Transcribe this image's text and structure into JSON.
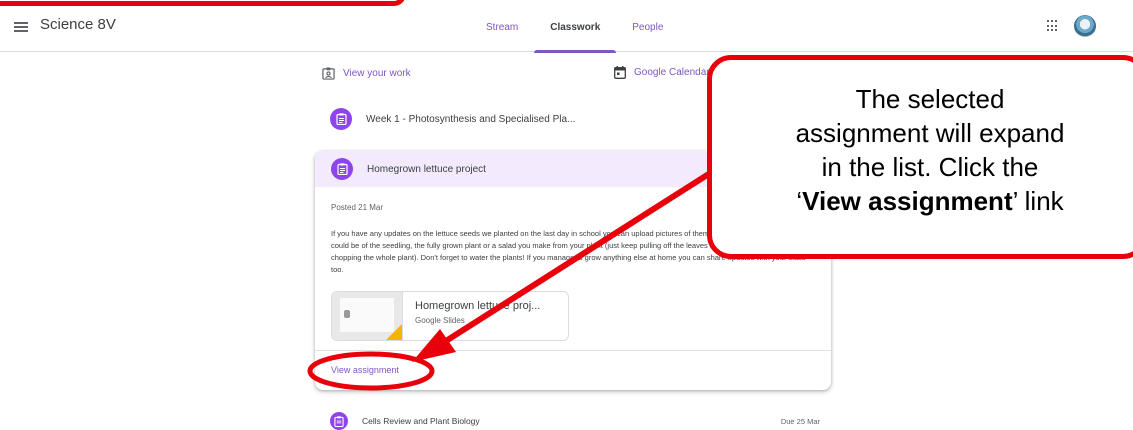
{
  "app": {
    "class_title": "Science 8V"
  },
  "tabs": [
    {
      "label": "Stream",
      "active": false
    },
    {
      "label": "Classwork",
      "active": true
    },
    {
      "label": "People",
      "active": false
    }
  ],
  "toolbar": {
    "view_your_work": "View your work",
    "google_calendar": "Google Calendar"
  },
  "topics": {
    "week1": "Week 1 - Photosynthesis and Specialised Pla..."
  },
  "assignment": {
    "title": "Homegrown lettuce project",
    "posted": "Posted 21 Mar",
    "description": "If you have any updates on the lettuce seeds we planted on the last day in school you can upload pictures of them to the Google slides. Pictures could be of the seedling, the fully grown plant or a salad you make from your plant (just keep pulling off the leaves as you need them rather than chopping the whole plant). Don't forget to water the plants! If you manage to grow anything else at home you can share updates with your class too.",
    "attachment_title": "Homegrown lettuce proj...",
    "attachment_type": "Google Slides",
    "view_assignment": "View assignment"
  },
  "next_item": {
    "title": "Cells Review and Plant Biology",
    "due": "Due 25 Mar"
  },
  "callout": {
    "line1": "The selected",
    "line2": "assignment will expand",
    "line3": "in the list. Click the",
    "quote_open": "‘",
    "bold": "View assignment",
    "quote_close": "’ link"
  },
  "colors": {
    "accent": "#7e57c2",
    "assignment_icon": "#8e44ec",
    "annotation_red": "#e8000b"
  },
  "icons": {
    "menu": "hamburger-menu-icon",
    "apps": "apps-grid-icon",
    "avatar": "avatar",
    "view_work": "assignment-ind-icon",
    "calendar": "calendar-icon",
    "assignment": "assignment-icon"
  }
}
